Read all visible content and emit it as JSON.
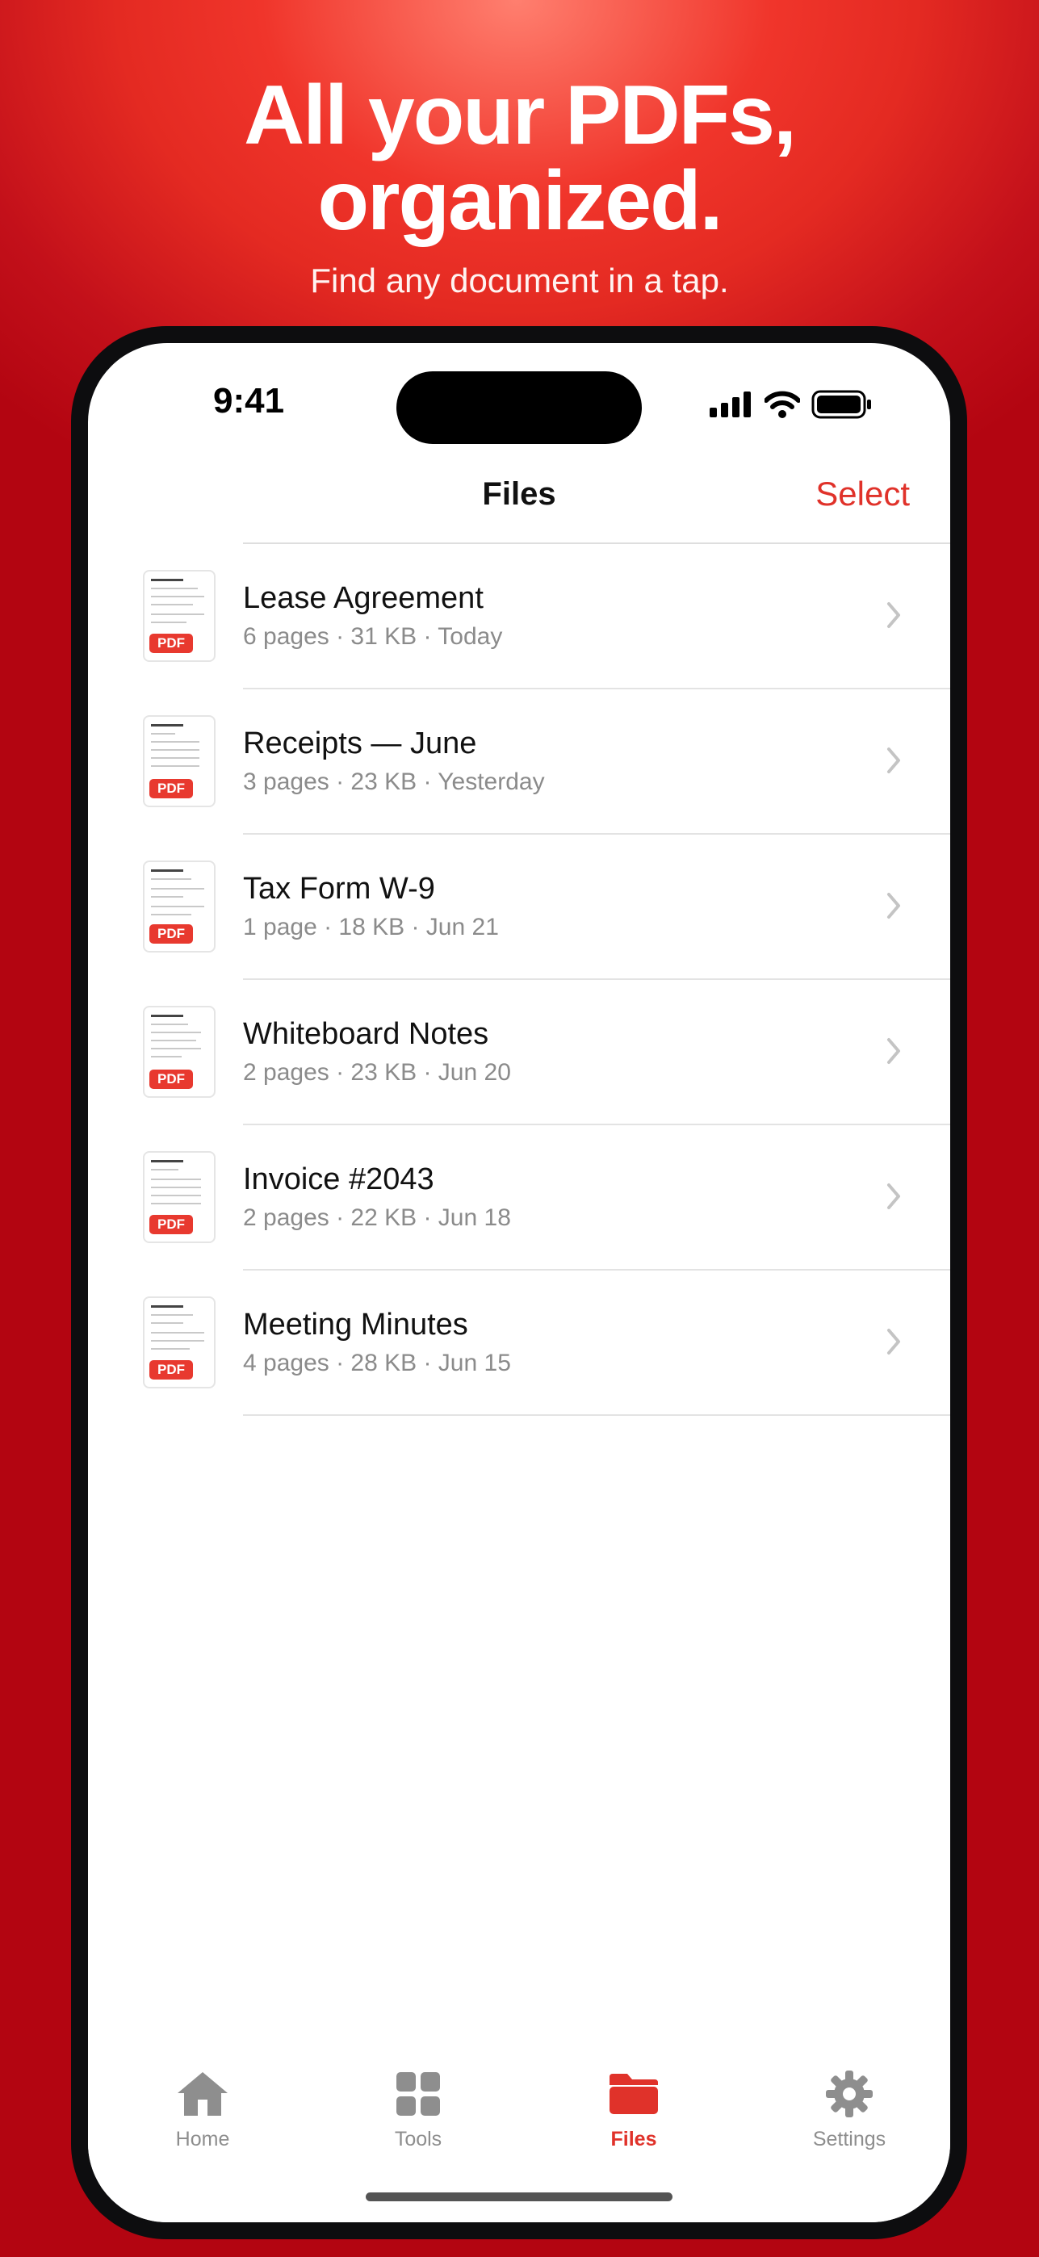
{
  "hero": {
    "title_line1": "All your PDFs,",
    "title_line2": "organized.",
    "subtitle": "Find any document in a tap."
  },
  "status_bar": {
    "time": "9:41",
    "icons": [
      "signal-icon",
      "wifi-icon",
      "battery-icon"
    ]
  },
  "nav": {
    "title": "Files",
    "select_label": "Select"
  },
  "files": [
    {
      "name": "Lease Agreement",
      "meta": "6 pages · 31 KB · Today",
      "badge": "PDF"
    },
    {
      "name": "Receipts — June",
      "meta": "3 pages · 23 KB · Yesterday",
      "badge": "PDF"
    },
    {
      "name": "Tax Form W-9",
      "meta": "1 page · 18 KB · Jun 21",
      "badge": "PDF"
    },
    {
      "name": "Whiteboard Notes",
      "meta": "2 pages · 23 KB · Jun 20",
      "badge": "PDF"
    },
    {
      "name": "Invoice #2043",
      "meta": "2 pages · 22 KB · Jun 18",
      "badge": "PDF"
    },
    {
      "name": "Meeting Minutes",
      "meta": "4 pages · 28 KB · Jun 15",
      "badge": "PDF"
    }
  ],
  "tabs": [
    {
      "label": "Home",
      "icon": "house-icon",
      "active": false
    },
    {
      "label": "Tools",
      "icon": "grid-icon",
      "active": false
    },
    {
      "label": "Files",
      "icon": "folder-icon",
      "active": true
    },
    {
      "label": "Settings",
      "icon": "gear-icon",
      "active": false
    }
  ],
  "colors": {
    "accent": "#e0322a",
    "badge": "#e8392f",
    "inactive_tab": "#8e8e8e"
  }
}
